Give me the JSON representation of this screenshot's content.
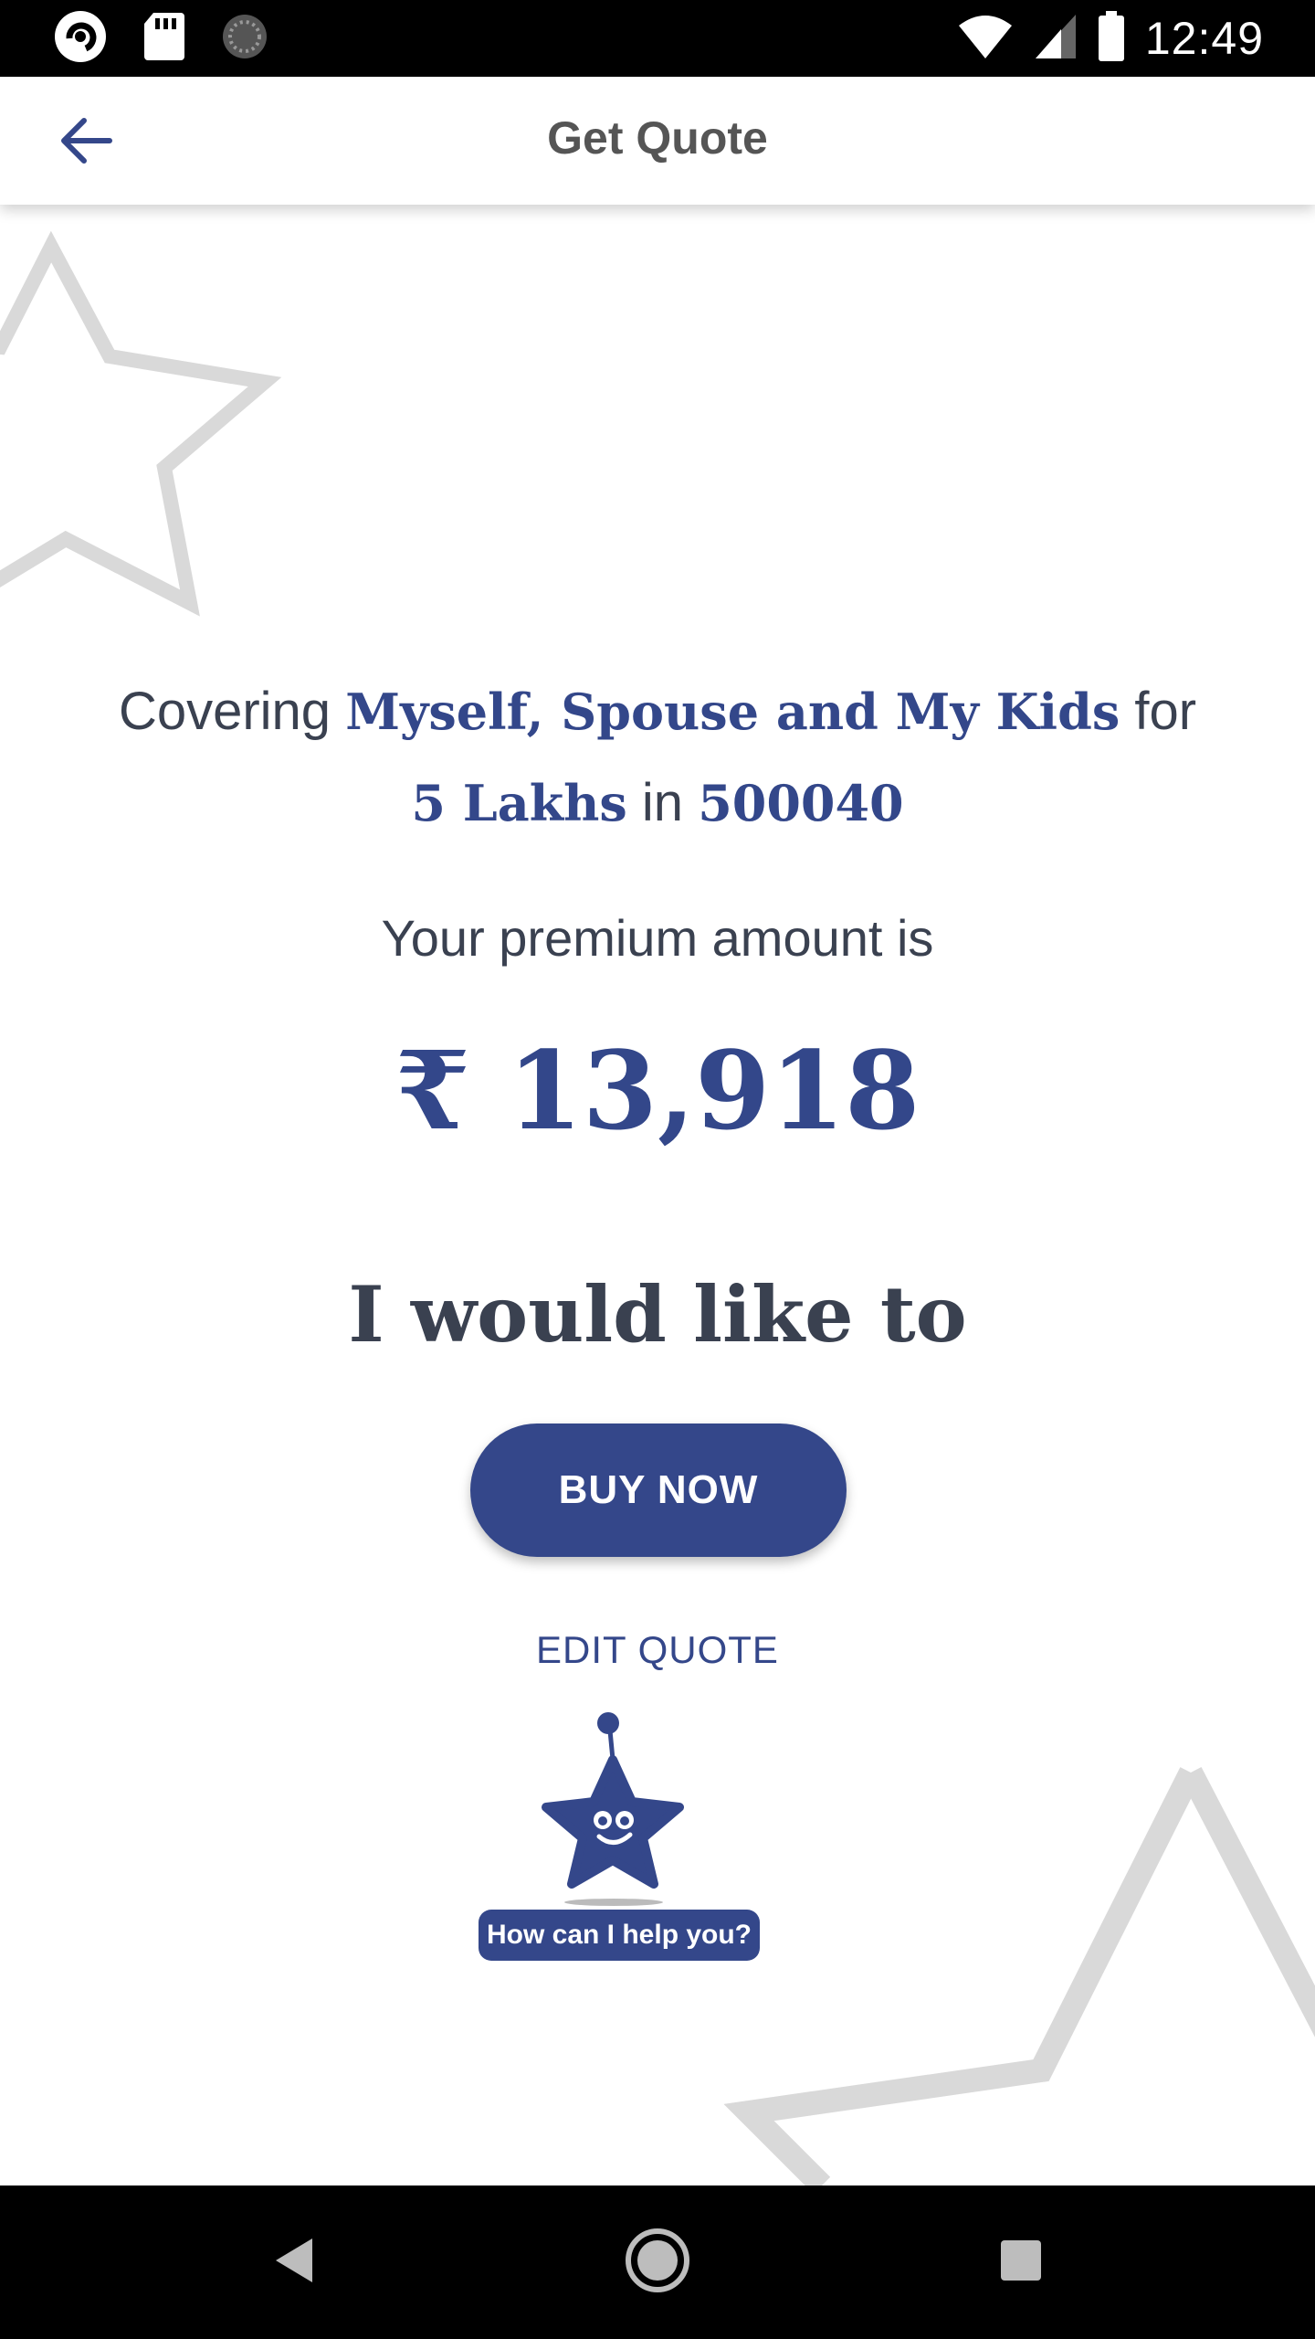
{
  "status_bar": {
    "time": "12:49",
    "icons": [
      "app-notification-icon",
      "sd-card-icon",
      "sync-icon",
      "wifi-icon",
      "cell-signal-icon",
      "battery-icon"
    ]
  },
  "app_bar": {
    "back_icon": "arrow-back-icon",
    "title": "Get Quote"
  },
  "quote": {
    "covering_prefix": "Covering",
    "members": "Myself, Spouse and My Kids",
    "for_word": "for",
    "sum_insured": "5 Lakhs",
    "in_word": "in",
    "pincode": "500040",
    "premium_label": "Your premium amount is",
    "premium_amount": "₹ 13,918"
  },
  "actions": {
    "heading": "I would like to",
    "buy_now": "BUY NOW",
    "edit_quote": "EDIT QUOTE"
  },
  "assistant": {
    "help_text": "How can I help you?"
  },
  "navigation": {
    "buttons": [
      "back-triangle-icon",
      "home-circle-icon",
      "recents-square-icon"
    ]
  },
  "colors": {
    "accent": "#34478a",
    "text_dark": "#3a4150",
    "decor_star": "#d9d9d9"
  }
}
